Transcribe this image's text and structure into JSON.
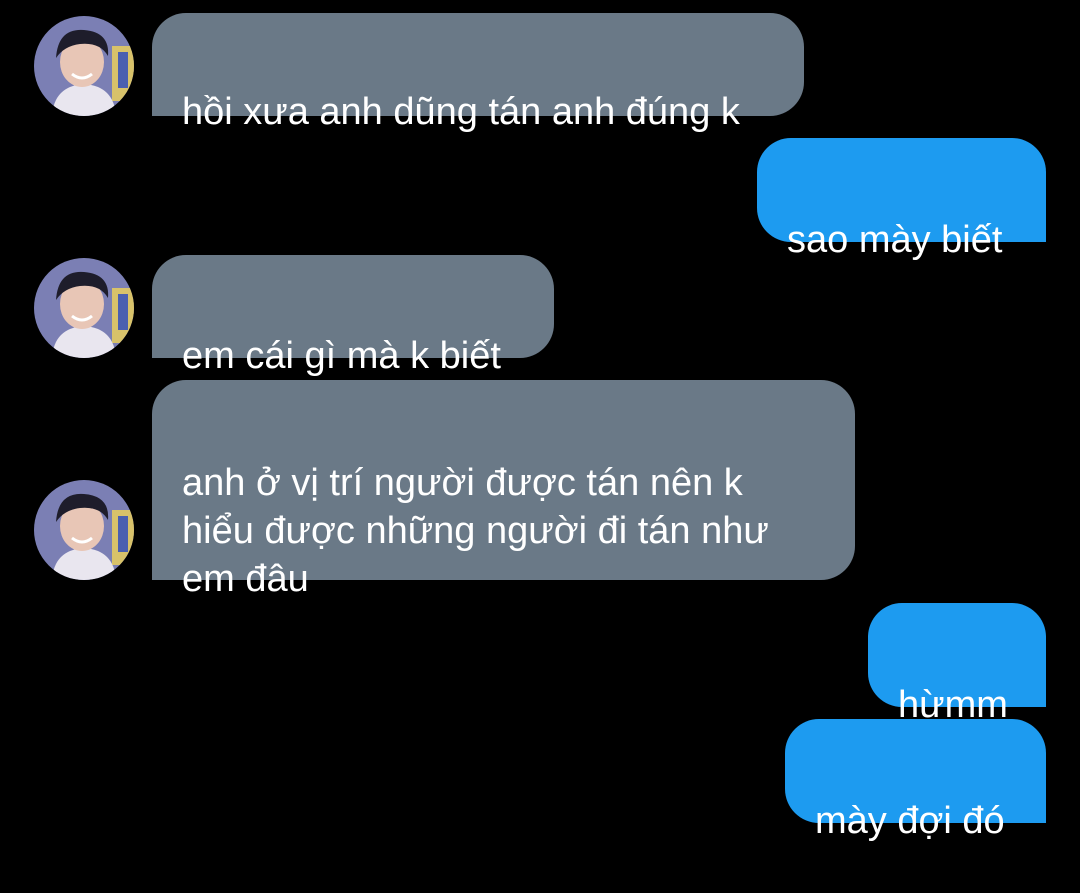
{
  "messages": [
    {
      "sender": "other",
      "text": "hồi xưa anh dũng tán anh đúng k"
    },
    {
      "sender": "self",
      "text": "sao mày biết"
    },
    {
      "sender": "other",
      "text": "em cái gì mà k biết"
    },
    {
      "sender": "other",
      "text": "anh ở vị trí người được tán nên k\nhiểu được những người đi tán như\nem đâu"
    },
    {
      "sender": "self",
      "text": "hừmm"
    },
    {
      "sender": "self",
      "text": "mày đợi đó"
    }
  ],
  "colors": {
    "background": "#000000",
    "incoming_bubble": "#6a7987",
    "outgoing_bubble": "#1d9bf0",
    "text": "#ffffff"
  },
  "icons": {
    "avatar": "contact-avatar"
  }
}
